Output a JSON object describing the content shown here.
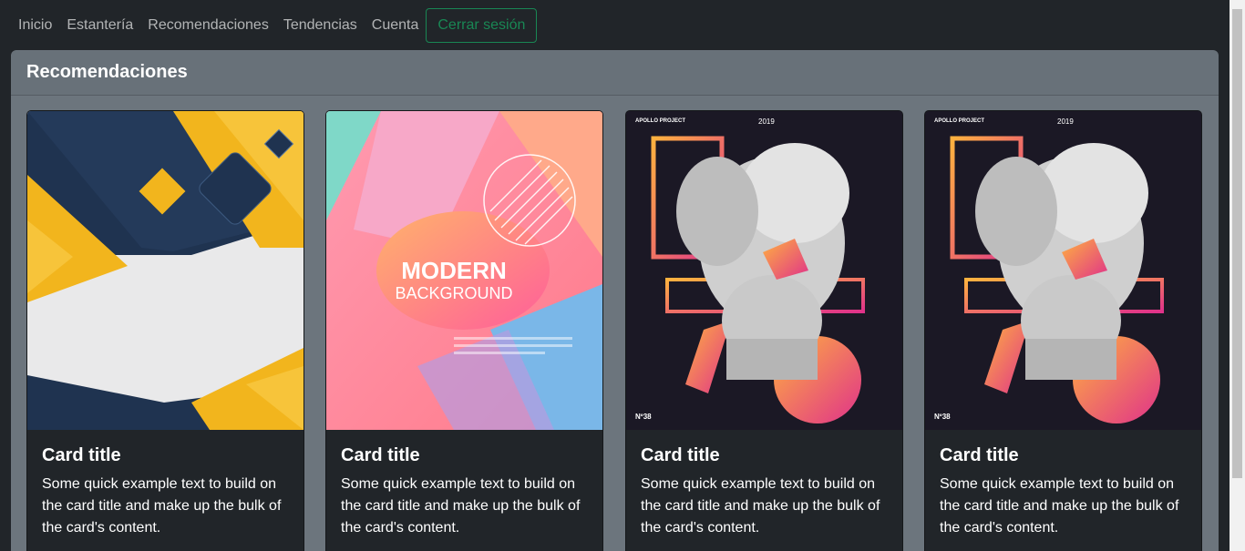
{
  "nav": {
    "links": [
      "Inicio",
      "Estantería",
      "Recomendaciones",
      "Tendencias",
      "Cuenta"
    ],
    "logout_label": "Cerrar sesión"
  },
  "section": {
    "title": "Recomendaciones"
  },
  "cards": [
    {
      "title": "Card title",
      "text": "Some quick example text to build on the card title and make up the bulk of the card's content.",
      "image": "geometric-yellow-navy-cover"
    },
    {
      "title": "Card title",
      "text": "Some quick example text to build on the card title and make up the bulk of the card's content.",
      "image": "modern-background-poster",
      "poster_heading": "MODERN",
      "poster_sub": "BACKGROUND"
    },
    {
      "title": "Card title",
      "text": "Some quick example text to build on the card title and make up the bulk of the card's content.",
      "image": "apollo-statue-poster",
      "poster_top_left": "APOLLO PROJECT",
      "poster_year": "2019",
      "poster_number": "Nº38"
    },
    {
      "title": "Card title",
      "text": "Some quick example text to build on the card title and make up the bulk of the card's content.",
      "image": "apollo-statue-poster",
      "poster_top_left": "APOLLO PROJECT",
      "poster_year": "2019",
      "poster_number": "Nº38"
    }
  ],
  "colors": {
    "navbar": "#212529",
    "panel": "#6c757d",
    "card": "#212529",
    "logout": "#198754"
  }
}
